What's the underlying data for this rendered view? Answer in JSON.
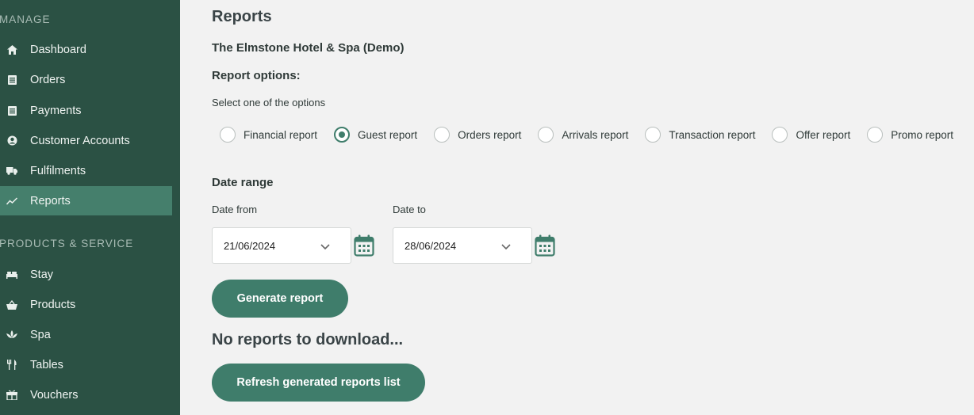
{
  "sidebar": {
    "manage_label": "MANAGE",
    "products_label": "PRODUCTS & SERVICE",
    "manage_items": [
      {
        "label": "Dashboard",
        "icon": "home-icon"
      },
      {
        "label": "Orders",
        "icon": "list-icon"
      },
      {
        "label": "Payments",
        "icon": "list-icon"
      },
      {
        "label": "Customer Accounts",
        "icon": "user-circle-icon"
      },
      {
        "label": "Fulfilments",
        "icon": "truck-icon"
      },
      {
        "label": "Reports",
        "icon": "chart-line-icon",
        "active": true
      }
    ],
    "product_items": [
      {
        "label": "Stay",
        "icon": "bed-icon"
      },
      {
        "label": "Products",
        "icon": "basket-icon"
      },
      {
        "label": "Spa",
        "icon": "lotus-icon"
      },
      {
        "label": "Tables",
        "icon": "utensils-icon"
      },
      {
        "label": "Vouchers",
        "icon": "gift-icon"
      }
    ]
  },
  "main": {
    "title": "Reports",
    "hotel_name": "The Elmstone Hotel & Spa (Demo)",
    "options_heading": "Report options:",
    "options_sub": "Select one of the options",
    "report_options": [
      {
        "label": "Financial report",
        "checked": false
      },
      {
        "label": "Guest report",
        "checked": true
      },
      {
        "label": "Orders report",
        "checked": false
      },
      {
        "label": "Arrivals report",
        "checked": false
      },
      {
        "label": "Transaction report",
        "checked": false
      },
      {
        "label": "Offer report",
        "checked": false
      },
      {
        "label": "Promo report",
        "checked": false
      }
    ],
    "date_range_heading": "Date range",
    "date_from_label": "Date from",
    "date_from_value": "21/06/2024",
    "date_to_label": "Date to",
    "date_to_value": "28/06/2024",
    "generate_button": "Generate report",
    "no_reports_text": "No reports to download...",
    "refresh_button": "Refresh generated reports list"
  },
  "colors": {
    "sidebar_bg": "#2b5144",
    "sidebar_active": "#457f6c",
    "accent": "#3f7d6b",
    "page_bg": "#f2f2f2"
  }
}
